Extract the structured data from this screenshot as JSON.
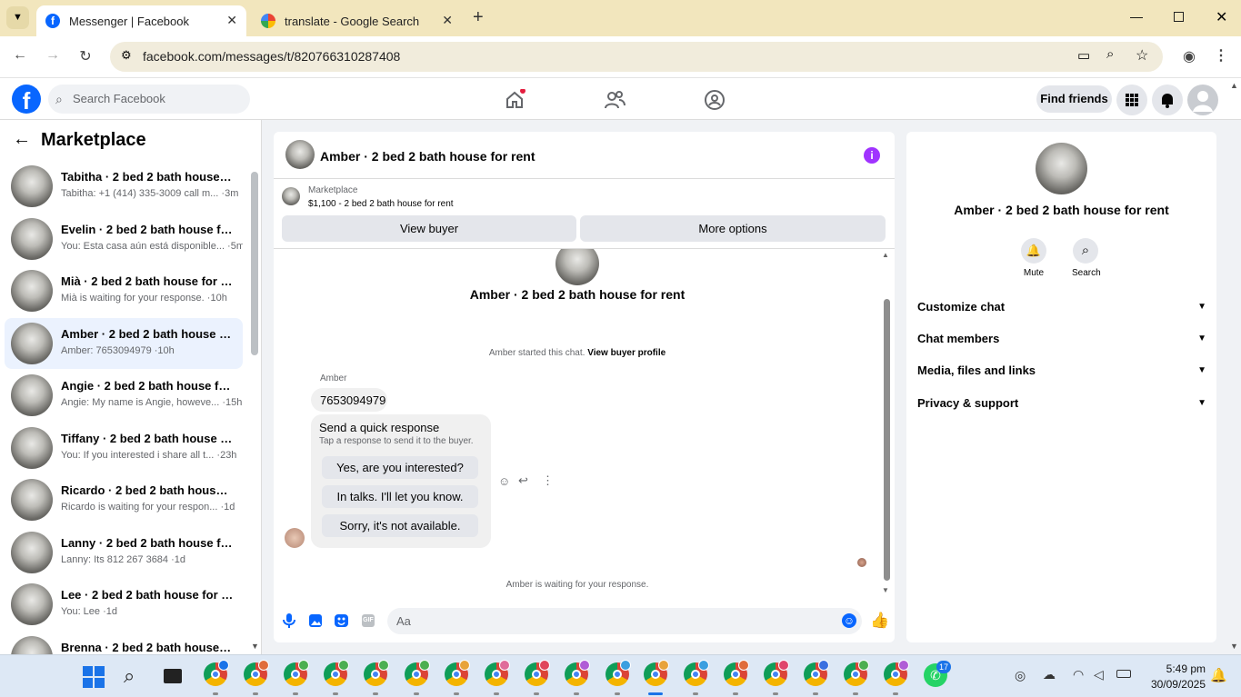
{
  "browser": {
    "tabs": [
      {
        "title": "Messenger | Facebook",
        "active": true
      },
      {
        "title": "translate - Google Search",
        "active": false
      }
    ],
    "url": "facebook.com/messages/t/820766310287408"
  },
  "header": {
    "search_placeholder": "Search Facebook",
    "find_friends": "Find friends"
  },
  "sidebar": {
    "title": "Marketplace",
    "conversations": [
      {
        "name": "Tabitha · 2 bed 2 bath house for...",
        "preview": "Tabitha: +1 (414) 335-3009 call m... ·3m",
        "selected": false
      },
      {
        "name": "Evelin · 2 bed 2 bath house for r...",
        "preview": "You: Esta casa aún está disponible... ·5m",
        "selected": false
      },
      {
        "name": "Mià · 2 bed 2 bath house for rent",
        "preview": "Mià is waiting for your response. ·10h",
        "selected": false
      },
      {
        "name": "Amber · 2 bed 2 bath house for ...",
        "preview": "Amber: 7653094979 ·10h",
        "selected": true
      },
      {
        "name": "Angie · 2 bed 2 bath house for r...",
        "preview": "Angie: My name is Angie, howeve... ·15h",
        "selected": false
      },
      {
        "name": "Tiffany · 2 bed 2 bath house for...",
        "preview": "You: If you interested i share all t... ·23h",
        "selected": false
      },
      {
        "name": "Ricardo · 2 bed 2 bath house fo...",
        "preview": "Ricardo is waiting for your respon... ·1d",
        "selected": false
      },
      {
        "name": "Lanny · 2 bed 2 bath house for r...",
        "preview": "Lanny: Its 812 267 3684 ·1d",
        "selected": false
      },
      {
        "name": "Lee · 2 bed 2 bath house for rent",
        "preview": "You: Lee ·1d",
        "selected": false
      },
      {
        "name": "Brenna · 2 bed 2 bath house f...",
        "preview": "",
        "selected": false
      }
    ]
  },
  "chat": {
    "title": "Amber · 2 bed 2 bath house for rent",
    "marketplace_label": "Marketplace",
    "listing": "$1,100 - 2 bed 2 bath house for rent",
    "view_buyer": "View buyer",
    "more_options": "More options",
    "thread_title": "Amber · 2 bed 2 bath house for rent",
    "started_text": "Amber started this chat.",
    "view_buyer_profile": "View buyer profile",
    "sender": "Amber",
    "message": "7653094979",
    "quick_title": "Send a quick response",
    "quick_sub": "Tap a response to send it to the buyer.",
    "quick_responses": [
      "Yes, are you interested?",
      "In talks. I'll let you know.",
      "Sorry, it's not available."
    ],
    "waiting": "Amber is waiting for your response.",
    "composer_placeholder": "Aa"
  },
  "panel": {
    "name": "Amber · 2 bed 2 bath house for rent",
    "mute": "Mute",
    "search": "Search",
    "rows": [
      "Customize chat",
      "Chat members",
      "Media, files and links",
      "Privacy & support"
    ]
  },
  "taskbar": {
    "time": "5:49 pm",
    "date": "30/09/2025",
    "whatsapp_badge": "17",
    "chrome_badge": "S"
  },
  "colors": {
    "fb_blue": "#0866ff",
    "messenger_purple": "#a033ff",
    "tabbar": "#f2e6bd"
  }
}
